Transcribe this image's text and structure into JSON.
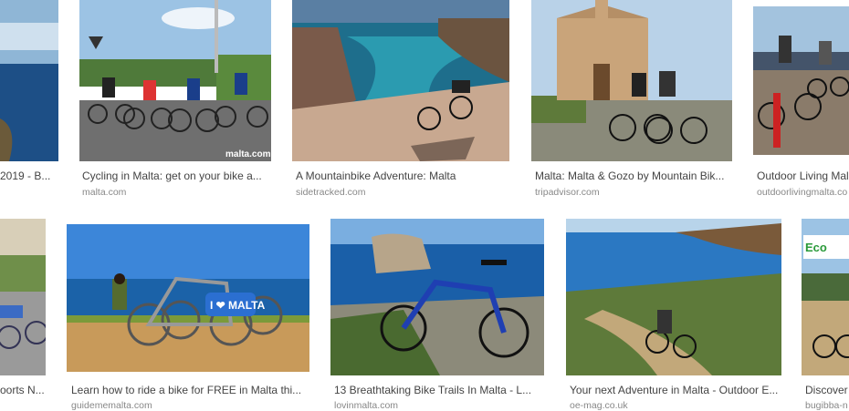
{
  "results": [
    {
      "title": "2019 - B...",
      "source": ""
    },
    {
      "title": "Cycling in Malta: get on your bike a...",
      "source": "malta.com"
    },
    {
      "title": "A Mountainbike Adventure: Malta",
      "source": "sidetracked.com"
    },
    {
      "title": "Malta: Malta & Gozo by Mountain Bik...",
      "source": "tripadvisor.com"
    },
    {
      "title": "Outdoor Living Mal",
      "source": "outdoorlivingmalta.co"
    },
    {
      "title": "oorts N...",
      "source": ""
    },
    {
      "title": "Learn how to ride a bike for FREE in Malta thi...",
      "source": "guidememalta.com"
    },
    {
      "title": "13 Breathtaking Bike Trails In Malta - L...",
      "source": "lovinmalta.com"
    },
    {
      "title": "Your next Adventure in Malta - Outdoor E...",
      "source": "oe-mag.co.uk"
    },
    {
      "title": "Discover",
      "source": "bugibba-n"
    }
  ],
  "watermarks": {
    "malta_com": "malta.com",
    "bike_logo": "I ❤ MALTA",
    "eco": "Eco"
  }
}
